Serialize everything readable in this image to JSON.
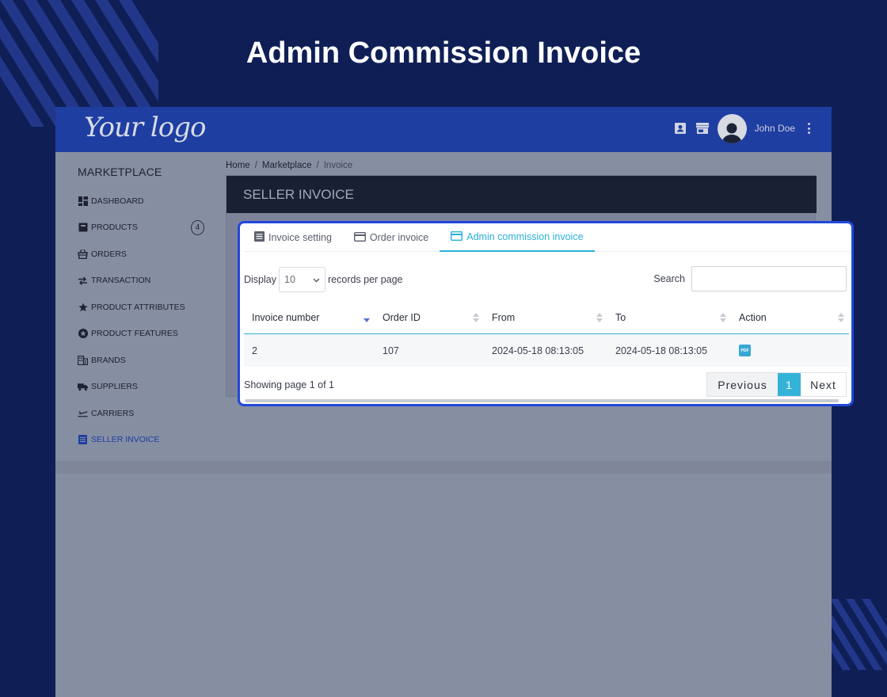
{
  "hero": {
    "title": "Admin Commission Invoice"
  },
  "topbar": {
    "logo": "Your logo",
    "user_name": "John Doe"
  },
  "sidebar": {
    "title": "MARKETPLACE",
    "items": [
      {
        "label": "DASHBOARD",
        "icon": "dashboard-icon"
      },
      {
        "label": "PRODUCTS",
        "icon": "box-icon",
        "badge": "4"
      },
      {
        "label": "ORDERS",
        "icon": "basket-icon"
      },
      {
        "label": "TRANSACTION",
        "icon": "swap-icon"
      },
      {
        "label": "PRODUCT ATTRIBUTES",
        "icon": "star-icon"
      },
      {
        "label": "PRODUCT FEATURES",
        "icon": "star-circle-icon"
      },
      {
        "label": "BRANDS",
        "icon": "building-icon"
      },
      {
        "label": "SUPPLIERS",
        "icon": "truck-icon"
      },
      {
        "label": "CARRIERS",
        "icon": "plane-icon"
      },
      {
        "label": "SELLER INVOICE",
        "icon": "list-icon",
        "active": true
      }
    ]
  },
  "breadcrumb": {
    "home": "Home",
    "sep1": "/",
    "marketplace": "Marketplace",
    "sep2": "/",
    "current": "Invoice"
  },
  "seller_invoice": {
    "title": "SELLER INVOICE"
  },
  "tabs": [
    {
      "label": "Invoice setting",
      "icon": "list-icon"
    },
    {
      "label": "Order invoice",
      "icon": "card-icon"
    },
    {
      "label": "Admin commission invoice",
      "icon": "card-icon",
      "active": true
    }
  ],
  "controls": {
    "display_label": "Display",
    "display_value": "10",
    "records_label": "records per page",
    "search_label": "Search"
  },
  "table": {
    "headers": [
      "Invoice number",
      "Order ID",
      "From",
      "To",
      "Action"
    ],
    "rows": [
      {
        "invoice_number": "2",
        "order_id": "107",
        "from": "2024-05-18 08:13:05",
        "to": "2024-05-18 08:13:05",
        "action_icon": "pdf-icon",
        "action_text": "PDF"
      }
    ]
  },
  "footer": {
    "showing": "Showing page 1 of 1",
    "previous": "Previous",
    "page": "1",
    "next": "Next"
  },
  "colors": {
    "background": "#0f1f56",
    "topbar": "#1f3ea1",
    "accent": "#2bb0d5",
    "panel_border": "#2148dc"
  }
}
